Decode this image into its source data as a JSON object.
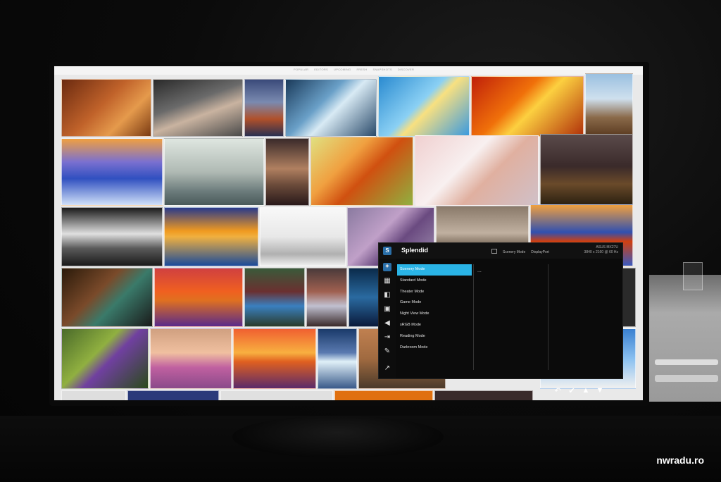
{
  "osd": {
    "title": "Splendid",
    "current_mode": "Scenery Mode",
    "input": "DisplayPort",
    "model": "ASUS MX27U",
    "resolution": "3840 x 2160 @",
    "refresh": "60 Hz",
    "menu_items": [
      "Scenery Mode",
      "Standard Mode",
      "Theater Mode",
      "Game Mode",
      "Night View Mode",
      "sRGB Mode",
      "Reading Mode",
      "Darkroom Mode"
    ],
    "selected_index": 0,
    "ellipsis": "...",
    "side_icons": [
      "splendid-icon",
      "bluelight-icon",
      "color-icon",
      "image-icon",
      "sound-icon",
      "input-icon",
      "system-icon",
      "shortcut-icon"
    ],
    "controls": [
      "back-icon",
      "confirm-icon",
      "up-icon",
      "down-icon"
    ]
  },
  "top_nav": [
    "POPULAR",
    "EDITORS",
    "UPCOMING",
    "FRESH",
    "SNAPSHOTS",
    "DISCOVER"
  ],
  "watermark": "nwradu.ro",
  "colors": {
    "osd_selected": "#2ab4e6",
    "osd_logo": "#2a6fa8"
  }
}
